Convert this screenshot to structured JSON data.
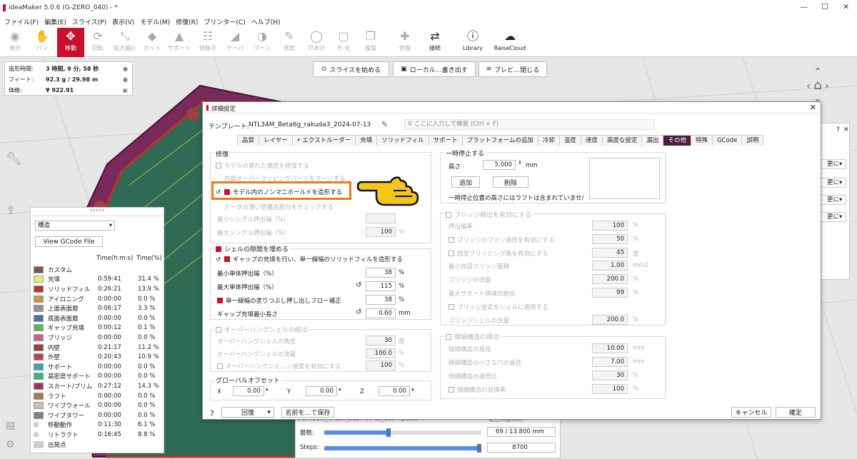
{
  "app": {
    "title": "ideaMaker 5.0.6 (G-ZERO_040) - *"
  },
  "menu": [
    "ファイル(F)",
    "編集(E)",
    "スライス(P)",
    "表示(V)",
    "モデル(M)",
    "修復(R)",
    "プリンター(C)",
    "ヘルプ(H)"
  ],
  "toolbar": [
    {
      "label": "表示",
      "icon": "eye-icon",
      "glyph": "◉",
      "state": "disabled"
    },
    {
      "label": "パン",
      "icon": "hand-icon",
      "glyph": "✋",
      "state": "disabled"
    },
    {
      "label": "移動",
      "icon": "move-icon",
      "glyph": "✥",
      "state": "active"
    },
    {
      "label": "回転",
      "icon": "rotate-icon",
      "glyph": "⟳",
      "state": "disabled"
    },
    {
      "label": "拡大縮小",
      "icon": "scale-icon",
      "glyph": "⤡",
      "state": "disabled"
    },
    {
      "label": "カット",
      "icon": "cut-icon",
      "glyph": "◆",
      "state": "disabled"
    },
    {
      "label": "サポート",
      "icon": "support-icon",
      "glyph": "▲",
      "state": "disabled"
    },
    {
      "label": "修飾子",
      "icon": "modifier-icon",
      "glyph": "☷",
      "state": "disabled"
    },
    {
      "label": "テーパ",
      "icon": "taper-icon",
      "glyph": "◢",
      "state": "disabled"
    },
    {
      "label": "ブーン",
      "icon": "boolean-icon",
      "glyph": "◑",
      "state": "disabled"
    },
    {
      "label": "測定",
      "icon": "measure-icon",
      "glyph": "✎",
      "state": "disabled"
    },
    {
      "label": "穴あけ",
      "icon": "hole-icon",
      "glyph": "◯",
      "state": "disabled"
    },
    {
      "label": "モ-化",
      "icon": "model-icon",
      "glyph": "▢",
      "state": "disabled"
    },
    {
      "label": "複製",
      "icon": "duplicate-icon",
      "glyph": "❐",
      "state": "disabled"
    },
    {
      "label": "修復",
      "icon": "repair-icon",
      "glyph": "✚",
      "state": "disabled"
    },
    {
      "label": "接続",
      "icon": "connect-icon",
      "glyph": "⇄",
      "state": "dark"
    },
    {
      "label": "Library",
      "icon": "library-icon",
      "glyph": "ⓘ",
      "state": "dark"
    },
    {
      "label": "RaiseCloud",
      "icon": "cloud-icon",
      "glyph": "☁",
      "state": "dark"
    }
  ],
  "stats": {
    "rows": [
      {
        "label": "造形時間:",
        "value": "3 時間, 9 分, 58 秒"
      },
      {
        "label": "フィート:",
        "value": "92.3 g / 29.98 m"
      },
      {
        "label": "価格:",
        "value": "¥ 922.91"
      }
    ]
  },
  "topbar": {
    "slice": "スライスを始める",
    "save": "ローカル…書き出す",
    "close": "プレビ…閉じる"
  },
  "legend": {
    "dropdown": "構造",
    "view_gcode": "View GCode File",
    "h_time": "Time(h:m:s)",
    "h_pct": "Time(%)",
    "rows": [
      {
        "name": "カスタム",
        "time": "",
        "pct": "",
        "color": "#7a5a4a"
      },
      {
        "name": "充填",
        "time": "0:59:41",
        "pct": "31.4 %",
        "color": "#e8e870"
      },
      {
        "name": "ソリッドフィル",
        "time": "0:26:21",
        "pct": "13.9 %",
        "color": "#c03030"
      },
      {
        "name": "アイロニング",
        "time": "0:00:00",
        "pct": "0.0 %",
        "color": "#d09040"
      },
      {
        "name": "上面表面層",
        "time": "0:06:17",
        "pct": "3.3 %",
        "color": "#9090a0"
      },
      {
        "name": "底面表面層",
        "time": "0:00:00",
        "pct": "0.0 %",
        "color": "#5070a0"
      },
      {
        "name": "ギャップ充填",
        "time": "0:00:12",
        "pct": "0.1 %",
        "color": "#60b060"
      },
      {
        "name": "ブリッジ",
        "time": "0:00:00",
        "pct": "0.0 %",
        "color": "#d06080"
      },
      {
        "name": "内壁",
        "time": "0:21:17",
        "pct": "11.2 %",
        "color": "#a04040"
      },
      {
        "name": "外壁",
        "time": "0:20:43",
        "pct": "10.9 %",
        "color": "#c04050"
      },
      {
        "name": "サポート",
        "time": "0:00:00",
        "pct": "0.0 %",
        "color": "#40a0b0"
      },
      {
        "name": "高密度サポート",
        "time": "0:00:00",
        "pct": "0.0 %",
        "color": "#40b080"
      },
      {
        "name": "スカート/ブリム",
        "time": "0:27:12",
        "pct": "14.3 %",
        "color": "#a03060"
      },
      {
        "name": "ラフト",
        "time": "0:00:00",
        "pct": "0.0 %",
        "color": "#a08050"
      },
      {
        "name": "ワイプウォール",
        "time": "0:00:00",
        "pct": "0.0 %",
        "color": "#c0c0c0"
      },
      {
        "name": "ワイプタワー",
        "time": "0:00:00",
        "pct": "0.0 %",
        "color": "#808080"
      },
      {
        "name": "移動動作",
        "time": "0:11:30",
        "pct": "6.1 %",
        "color": ""
      },
      {
        "name": "リトラクト",
        "time": "0:16:45",
        "pct": "8.8 %",
        "color": ""
      },
      {
        "name": "出発点",
        "time": "",
        "pct": "",
        "color": ""
      }
    ]
  },
  "bottom": {
    "filename": "POTICON_NTE3x_2024-07-15_2354.gcode",
    "current": "現在の層のみ",
    "layer_label": "層数:",
    "layer_value": "69 / 13.800 mm",
    "steps_label": "Steps:",
    "steps_value": "8700",
    "layer_fraction": 0.41,
    "steps_fraction": 1.0
  },
  "dialog": {
    "title": "詳細設定",
    "template_label": "テンプレート:",
    "template_name": "NTL34M_Beta6g_rakuda3_2024-07-13",
    "search_placeholder": "ここに入力して検索 (Ctrl + F)",
    "tabs": [
      "品質",
      "レイヤー",
      "• エクストルーダー",
      "充填",
      "ソリッドフィル",
      "サポート",
      "プラットフォームの追加",
      "冷却",
      "温度",
      "速度",
      "高度な設定",
      "漏出",
      "その他",
      "特殊",
      "GCode",
      "説明"
    ],
    "selected_tab": "その他",
    "repair": {
      "title": "修復",
      "items": [
        "モデルの壊れた構造を修復する",
        "内部オーバーラッピングパーツをマージする",
        "モデル内のノンマニホールドを造形する",
        "データの薄い壁構造部分をチェックする"
      ],
      "min_single": "最小シングル押出幅（%）",
      "max_single": "最大シングル押出幅（%）",
      "max_single_val": "100"
    },
    "shell": {
      "title": "シェルの隙間を埋める",
      "gap_fill": "ギャップの充填を行い、単一線幅のソリッドフィルを造形する",
      "rows": [
        {
          "label": "最小単体押出幅（%）",
          "value": "38",
          "unit": "%"
        },
        {
          "label": "最大単体押出幅（%）",
          "value": "115",
          "unit": "%"
        },
        {
          "label": "単一線幅の塗りつぶし押し出しフロー補正",
          "value": "38",
          "unit": "%"
        },
        {
          "label": "ギャップ充填最小長さ",
          "value": "0.60",
          "unit": "mm"
        }
      ]
    },
    "overhang": {
      "title": "オーバーハングシェルの検出",
      "rows": [
        {
          "label": "オーバーハングシェルの角度",
          "value": "30",
          "unit": "度"
        },
        {
          "label": "オーバーハングシェルの流量",
          "value": "100.0",
          "unit": "%"
        },
        {
          "label": "オーバーハングシェ…ン速度を有効にする",
          "value": "100",
          "unit": "%"
        }
      ]
    },
    "offset": {
      "title": "グローバルオフセット",
      "x_label": "X",
      "x": "0.00",
      "y_label": "Y",
      "y": "0.00",
      "z_label": "Z",
      "z": "0.00"
    },
    "pause": {
      "title": "一時停止する",
      "height_label": "高さ",
      "height": "5.000",
      "unit": "mm",
      "add": "追加",
      "delete": "削除",
      "note": "一時停止位置の高さにはラフトは含まれていませ/"
    },
    "bridge": {
      "title": "ブリッジ検出を有効にする",
      "rows": [
        {
          "label": "押出幅率",
          "value": "100",
          "unit": "%"
        },
        {
          "label": "ブリッジのファン速度を有効にする",
          "value": "50",
          "unit": "%"
        },
        {
          "label": "固定ブリッジング角を有効にする",
          "value": "45",
          "unit": "度"
        },
        {
          "label": "最小許容ブリッジ面積",
          "value": "1.00",
          "unit": "mm2"
        },
        {
          "label": "ブリッジの流量",
          "value": "200.0",
          "unit": "%"
        },
        {
          "label": "最大サポート領域の割合",
          "value": "99",
          "unit": "%"
        },
        {
          "label": "ブリッジ設定をシェルに適用する",
          "value": "",
          "unit": ""
        },
        {
          "label": "ブリッジシェルの流量",
          "value": "200.0",
          "unit": "%"
        }
      ]
    },
    "micro": {
      "title": "微細構造の検出",
      "rows": [
        {
          "label": "微細構造の直径",
          "value": "10.00",
          "unit": "mm"
        },
        {
          "label": "微細構造の小さな穴の直径",
          "value": "7.00",
          "unit": "mm"
        },
        {
          "label": "微細構造の速度比",
          "value": "30",
          "unit": "%"
        },
        {
          "label": "微細構造の充填率",
          "value": "100",
          "unit": "%"
        }
      ]
    },
    "footer": {
      "help": "?",
      "revert": "回復",
      "save_as": "名前を…て保存",
      "cancel": "キャンセル",
      "ok": "確定"
    }
  },
  "right_panel": {
    "rows": [
      "更に",
      "更に",
      "更に",
      "更に"
    ]
  },
  "colors": {
    "accent": "#c8102e",
    "tab_selected": "#4a1f3d",
    "highlight": "#f07a1a",
    "plate": "#8b2a6a"
  }
}
